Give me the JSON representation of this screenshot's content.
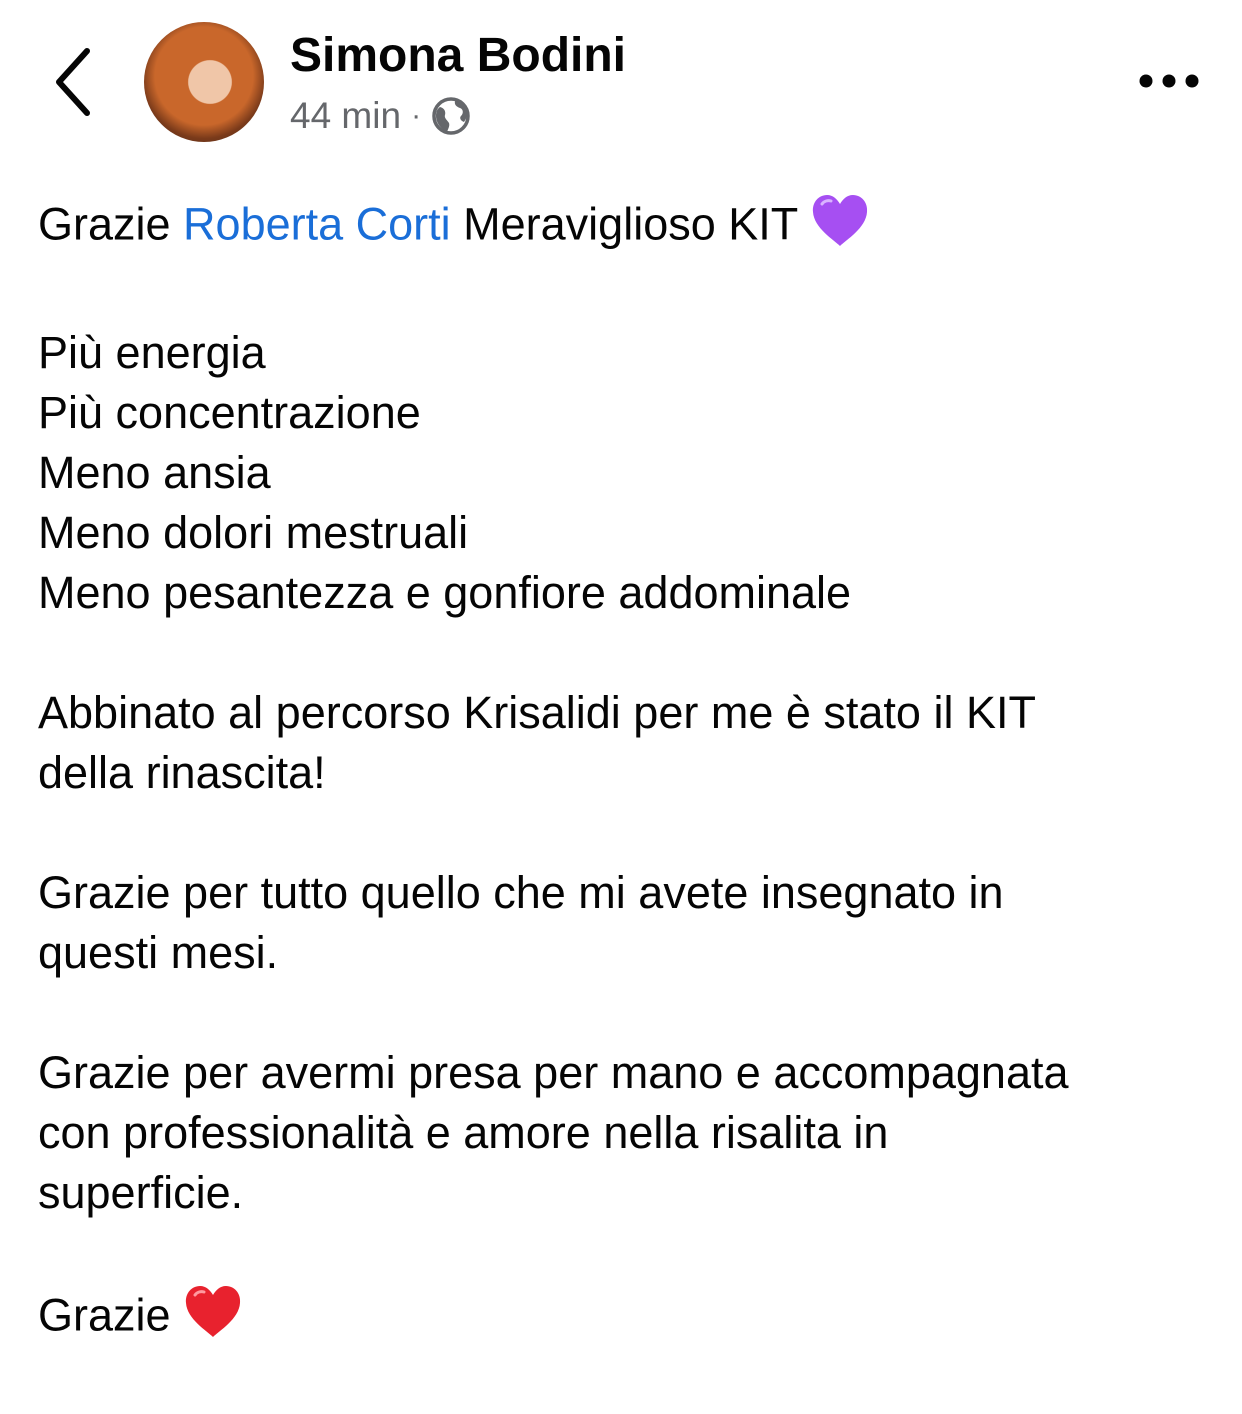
{
  "header": {
    "back_icon": "chevron-left-icon",
    "author_name": "Simona Bodini",
    "timestamp": "44 min",
    "separator": "·",
    "privacy_icon": "globe-icon",
    "more_icon": "more-horizontal-icon"
  },
  "post": {
    "first_line": {
      "before": "Grazie ",
      "mention": "Roberta Corti",
      "after": " Meraviglioso KIT",
      "emoji": "purple-heart-icon"
    },
    "benefits": [
      "Più energia",
      "Più concentrazione",
      "Meno ansia",
      "Meno dolori mestruali",
      "Meno pesantezza e gonfiore addominale"
    ],
    "paragraph_1": [
      "Abbinato al percorso Krisalidi per me è stato il KIT",
      "della rinascita!"
    ],
    "paragraph_2": [
      "Grazie per tutto quello che mi avete insegnato in",
      "questi mesi."
    ],
    "paragraph_3": [
      "Grazie per avermi presa per mano e accompagnata",
      "con professionalità e amore nella risalita in",
      "superficie."
    ],
    "closing": {
      "text": "Grazie",
      "emoji": "red-heart-icon"
    }
  },
  "colors": {
    "mention": "#1a6ed8",
    "text": "#050505",
    "secondary": "#65676b",
    "purple_heart": "#a64ff2",
    "red_heart": "#e8222e"
  }
}
